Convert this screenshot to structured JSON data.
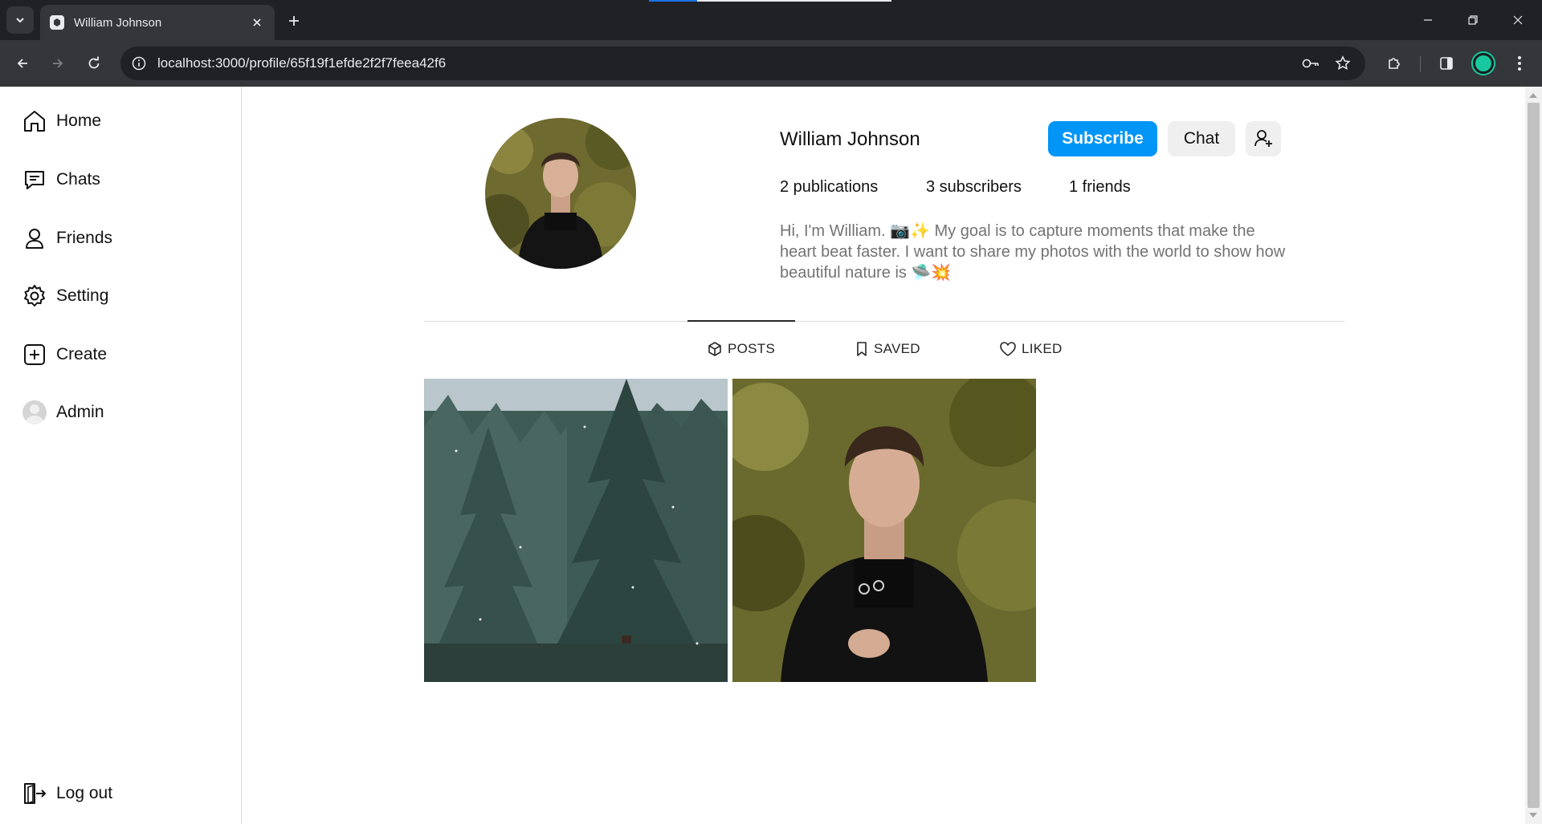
{
  "browser": {
    "tab_title": "William Johnson",
    "url": "localhost:3000/profile/65f19f1efde2f2f7feea42f6"
  },
  "sidebar": {
    "items": [
      {
        "label": "Home",
        "icon": "home-icon"
      },
      {
        "label": "Chats",
        "icon": "chat-bubble-icon"
      },
      {
        "label": "Friends",
        "icon": "user-icon"
      },
      {
        "label": "Setting",
        "icon": "gear-icon"
      },
      {
        "label": "Create",
        "icon": "plus-square-icon"
      },
      {
        "label": "Admin",
        "icon": "avatar-icon"
      }
    ],
    "logout_label": "Log out"
  },
  "profile": {
    "username": "William Johnson",
    "subscribe_label": "Subscribe",
    "chat_label": "Chat",
    "stats": {
      "publications": "2 publications",
      "subscribers": "3 subscribers",
      "friends": "1 friends"
    },
    "bio": "Hi, I'm William. 📷✨ My goal is to capture moments that make the heart beat faster. I want to share my photos with the world to show how beautiful nature is 🛸💥"
  },
  "tabs": {
    "posts": "POSTS",
    "saved": "SAVED",
    "liked": "LIKED",
    "active": "posts"
  },
  "posts": [
    {
      "subject": "snowy fir forest"
    },
    {
      "subject": "man in black turtleneck"
    }
  ],
  "colors": {
    "accent": "#0095f6",
    "chrome_dark": "#202124",
    "chrome_toolbar": "#35363a"
  }
}
